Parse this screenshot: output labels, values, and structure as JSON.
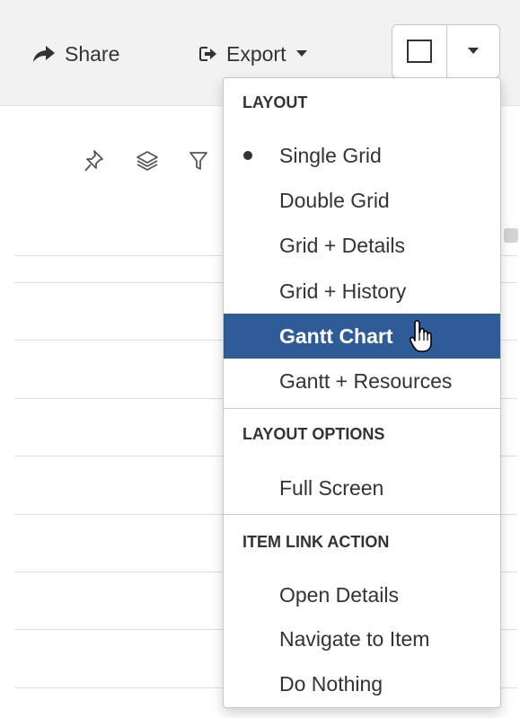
{
  "toolbar": {
    "share_label": "Share",
    "share_icon": "share-arrow-icon",
    "export_label": "Export",
    "export_icon": "export-icon"
  },
  "grid_toolbar": {
    "icons": [
      "pin-icon",
      "layers-icon",
      "filter-icon"
    ]
  },
  "menu": {
    "sections": [
      {
        "header": "LAYOUT",
        "items": [
          {
            "label": "Single Grid",
            "selected": true
          },
          {
            "label": "Double Grid"
          },
          {
            "label": "Grid + Details"
          },
          {
            "label": "Grid + History"
          },
          {
            "label": "Gantt Chart",
            "highlighted": true
          },
          {
            "label": "Gantt + Resources"
          }
        ]
      },
      {
        "header": "LAYOUT OPTIONS",
        "items": [
          {
            "label": "Full Screen"
          }
        ]
      },
      {
        "header": "ITEM LINK ACTION",
        "items": [
          {
            "label": "Open Details"
          },
          {
            "label": "Navigate to Item"
          },
          {
            "label": "Do Nothing"
          }
        ]
      }
    ]
  },
  "colors": {
    "highlight": "#2f5c98",
    "toolbar_bg": "#f2f2f2"
  }
}
